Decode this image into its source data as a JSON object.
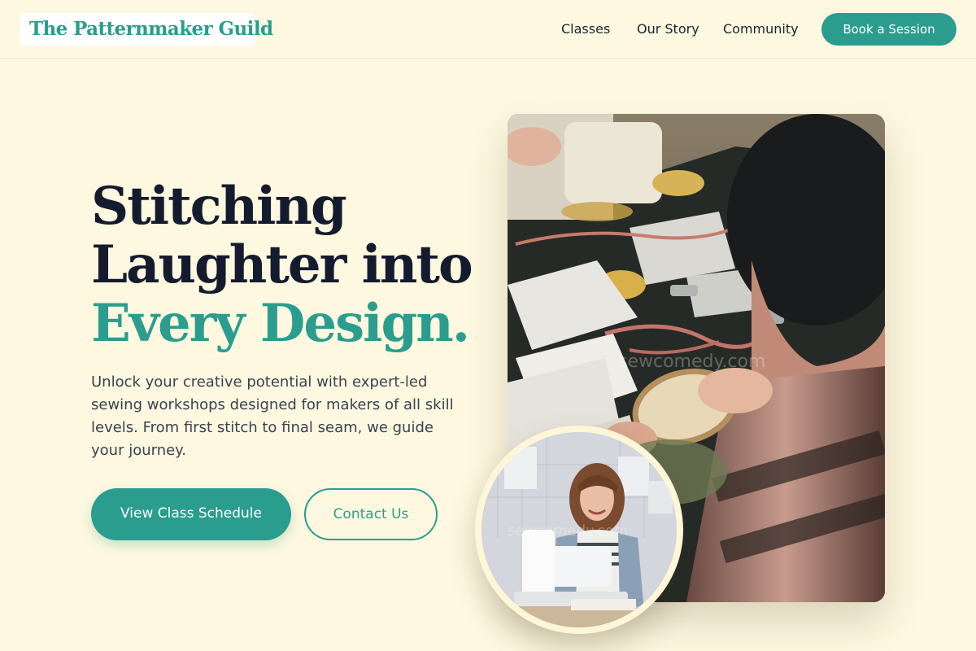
{
  "header": {
    "logo_text": "The Patternmaker Guild",
    "nav": {
      "classes": "Classes",
      "our_story": "Our Story",
      "community": "Community"
    },
    "cta_label": "Book a Session"
  },
  "hero": {
    "headline_line1": "Stitching",
    "headline_line2": "Laughter into",
    "headline_line3": "Every Design.",
    "description": "Unlock your creative potential with expert-led sewing workshops designed for makers of all skill levels. From first stitch to final seam, we guide your journey.",
    "primary_button": "View Class Schedule",
    "secondary_button": "Contact Us"
  },
  "images": {
    "main_watermark": "sewcomedy.com",
    "circle_watermark": "sewcomedy.com"
  },
  "colors": {
    "background": "#fef8e0",
    "accent": "#2a9d8f",
    "heading": "#141b2e",
    "body_text": "#3a4252"
  }
}
